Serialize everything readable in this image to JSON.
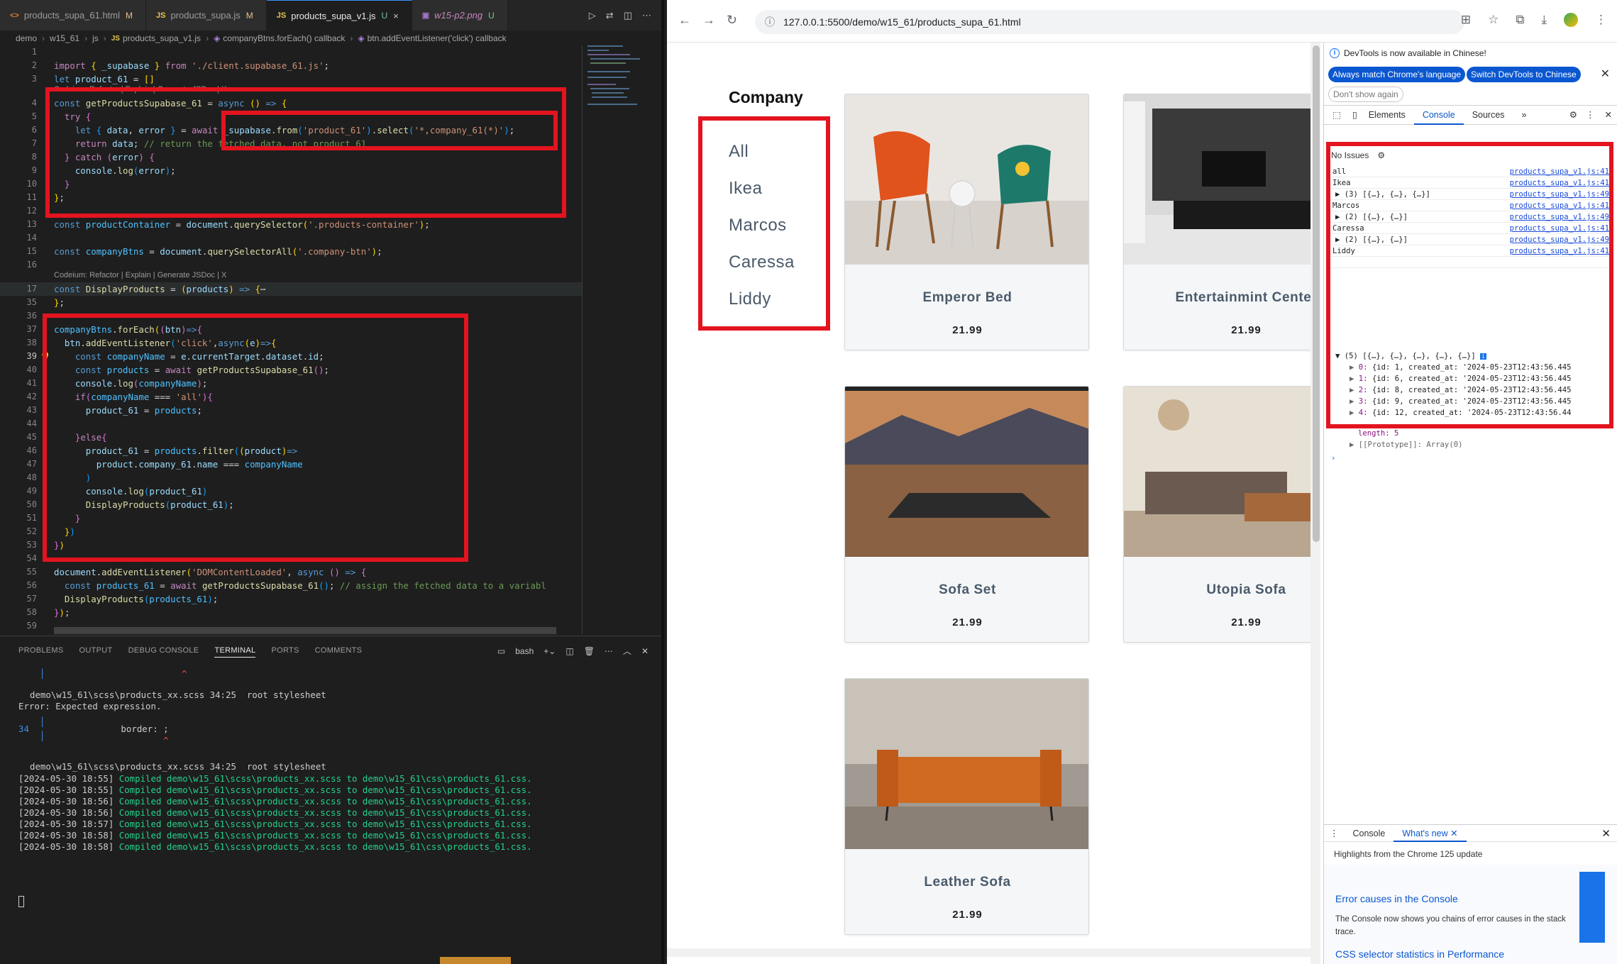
{
  "vscode": {
    "tabs": [
      {
        "label": "products_supa_61.html",
        "indicator": "M",
        "kind": "html"
      },
      {
        "label": "products_supa.js",
        "indicator": "M",
        "kind": "js"
      },
      {
        "label": "products_supa_v1.js",
        "indicator": "U",
        "kind": "js",
        "active": true
      },
      {
        "label": "w15-p2.png",
        "indicator": "U",
        "kind": "img"
      }
    ],
    "breadcrumbs": [
      "demo",
      "w15_61",
      "js",
      "products_supa_v1.js",
      "companyBtns.forEach() callback",
      "btn.addEventListener('click') callback"
    ],
    "codelens_a": "Codeium: Refactor | Explain | Generate JSDoc | X",
    "codelens_b": "Codeium: Refactor | Explain | Generate JSDoc | X",
    "panel_tabs": [
      "PROBLEMS",
      "OUTPUT",
      "DEBUG CONSOLE",
      "TERMINAL",
      "PORTS",
      "COMMENTS"
    ],
    "terminal_shell": "bash",
    "terminal": {
      "err1_path": "demo\\w15_61\\scss\\products_xx.scss 34:25  root stylesheet",
      "err_msg": "Error: Expected expression.",
      "err_line_no": "34",
      "err_line_text": "              border: ;",
      "err_caret": "                      ^",
      "err2_path": "demo\\w15_61\\scss\\products_xx.scss 34:25  root stylesheet",
      "compiled": [
        {
          "ts": "[2024-05-30 18:55]",
          "msg": "Compiled demo\\w15_61\\scss\\products_xx.scss to demo\\w15_61\\css\\products_61.css."
        },
        {
          "ts": "[2024-05-30 18:55]",
          "msg": "Compiled demo\\w15_61\\scss\\products_xx.scss to demo\\w15_61\\css\\products_61.css."
        },
        {
          "ts": "[2024-05-30 18:56]",
          "msg": "Compiled demo\\w15_61\\scss\\products_xx.scss to demo\\w15_61\\css\\products_61.css."
        },
        {
          "ts": "[2024-05-30 18:56]",
          "msg": "Compiled demo\\w15_61\\scss\\products_xx.scss to demo\\w15_61\\css\\products_61.css."
        },
        {
          "ts": "[2024-05-30 18:57]",
          "msg": "Compiled demo\\w15_61\\scss\\products_xx.scss to demo\\w15_61\\css\\products_61.css."
        },
        {
          "ts": "[2024-05-30 18:58]",
          "msg": "Compiled demo\\w15_61\\scss\\products_xx.scss to demo\\w15_61\\css\\products_61.css."
        },
        {
          "ts": "[2024-05-30 18:58]",
          "msg": "Compiled demo\\w15_61\\scss\\products_xx.scss to demo\\w15_61\\css\\products_61.css."
        }
      ]
    }
  },
  "chrome": {
    "url": "127.0.0.1:5500/demo/w15_61/products_supa_61.html",
    "company_title": "Company",
    "companies": [
      "All",
      "Ikea",
      "Marcos",
      "Caressa",
      "Liddy"
    ],
    "products": [
      {
        "name": "Emperor Bed",
        "price": "21.99"
      },
      {
        "name": "Entertainmint Center",
        "price": "21.99"
      },
      {
        "name": "Sofa Set",
        "price": "21.99"
      },
      {
        "name": "Utopia Sofa",
        "price": "21.99"
      },
      {
        "name": "Leather Sofa",
        "price": "21.99"
      }
    ]
  },
  "devtools": {
    "notice": "DevTools is now available in Chinese!",
    "btn_match": "Always match Chrome's language",
    "btn_switch": "Switch DevTools to Chinese",
    "btn_dont_show": "Don't show again",
    "tabs": [
      "Elements",
      "Console",
      "Sources"
    ],
    "issues": "No Issues",
    "logs": [
      {
        "msg": "all",
        "src": "products_supa_v1.js:41"
      },
      {
        "msg": "Ikea",
        "src": "products_supa_v1.js:41"
      },
      {
        "msg": "▶ (3) [{…}, {…}, {…}]",
        "src": "products_supa_v1.js:49"
      },
      {
        "msg": "Marcos",
        "src": "products_supa_v1.js:41"
      },
      {
        "msg": "▶ (2) [{…}, {…}]",
        "src": "products_supa_v1.js:49"
      },
      {
        "msg": "Caressa",
        "src": "products_supa_v1.js:41"
      },
      {
        "msg": "▶ (2) [{…}, {…}]",
        "src": "products_supa_v1.js:49"
      },
      {
        "msg": "Liddy",
        "src": "products_supa_v1.js:41"
      }
    ],
    "expanded_header": "▼ (5) [{…}, {…}, {…}, {…}, {…}]",
    "expanded_items": [
      {
        "idx": "0:",
        "body": "{id: 1, created_at: '2024-05-23T12:43:56.445"
      },
      {
        "idx": "1:",
        "body": "{id: 6, created_at: '2024-05-23T12:43:56.445"
      },
      {
        "idx": "2:",
        "body": "{id: 8, created_at: '2024-05-23T12:43:56.445"
      },
      {
        "idx": "3:",
        "body": "{id: 9, created_at: '2024-05-23T12:43:56.445"
      },
      {
        "idx": "4:",
        "body": "{id: 12, created_at: '2024-05-23T12:43:56.44"
      }
    ],
    "length_line": "length: 5",
    "proto_line": "▶ [[Prototype]]: Array(0)",
    "drawer_tabs": [
      "Console",
      "What's new"
    ],
    "drawer_highlight": "Highlights from the Chrome 125 update",
    "drawer_title1": "Error causes in the Console",
    "drawer_body1": "The Console now shows you chains of error causes in the stack trace.",
    "drawer_title2": "CSS selector statistics in Performance"
  }
}
